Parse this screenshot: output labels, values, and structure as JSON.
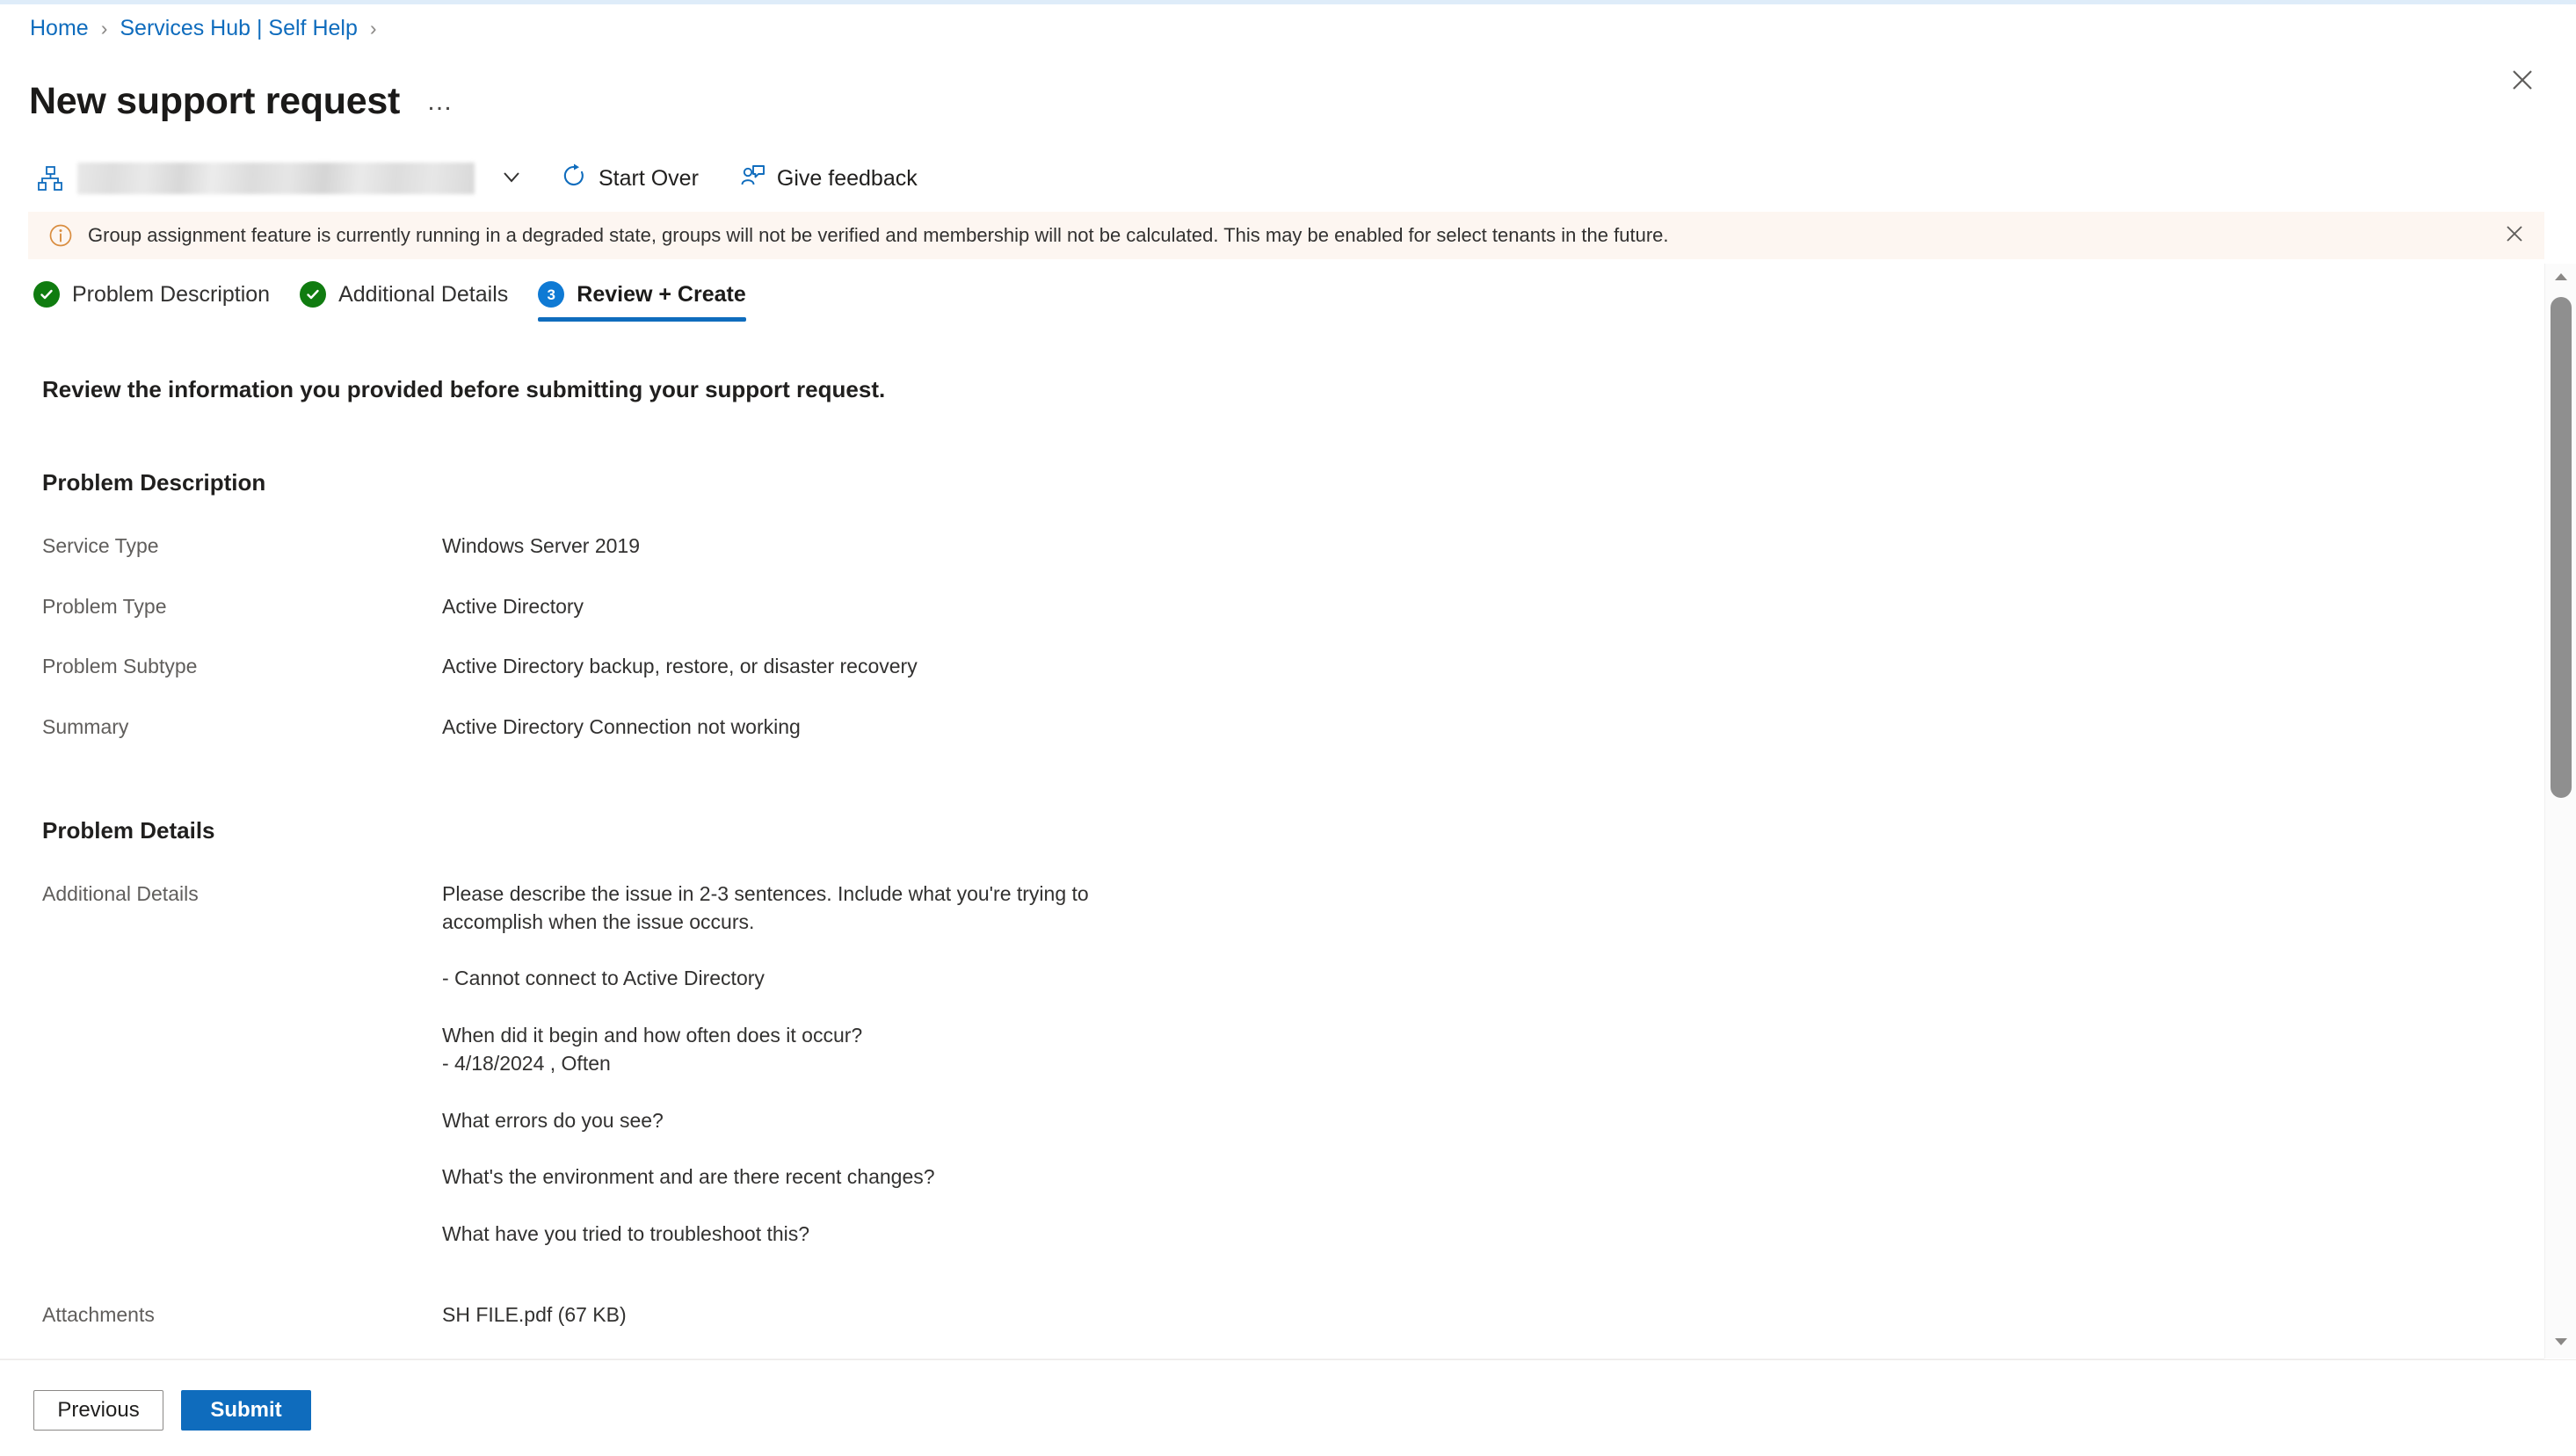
{
  "breadcrumb": {
    "items": [
      {
        "label": "Home"
      },
      {
        "label": "Services Hub | Self Help"
      }
    ],
    "separator": "›"
  },
  "header": {
    "title": "New support request",
    "more_menu_label": "…",
    "close_label": "Close"
  },
  "command_bar": {
    "org_picker": {
      "icon": "org-hierarchy-icon",
      "value": "",
      "redacted": true,
      "chevron": "chevron-down-icon"
    },
    "buttons": [
      {
        "label": "Start Over",
        "icon": "refresh-icon"
      },
      {
        "label": "Give feedback",
        "icon": "feedback-person-icon"
      }
    ]
  },
  "message_bar": {
    "icon": "info-icon",
    "text": "Group assignment feature is currently running in a degraded state, groups will not be verified and membership will not be calculated. This may be enabled for select tenants in the future.",
    "dismiss_label": "Dismiss",
    "background": "#fdf6f1",
    "icon_color": "#d98d3f"
  },
  "wizard": {
    "steps": [
      {
        "label": "Problem Description",
        "state": "done",
        "badge": "✓"
      },
      {
        "label": "Additional Details",
        "state": "done",
        "badge": "✓"
      },
      {
        "label": "Review + Create",
        "state": "current",
        "badge": "3"
      }
    ],
    "done_color": "#107c10",
    "current_color": "#0f7ad4"
  },
  "main": {
    "lead": "Review the information you provided before submitting your support request.",
    "sections": [
      {
        "title": "Problem Description",
        "rows": [
          {
            "label": "Service Type",
            "value": "Windows Server 2019"
          },
          {
            "label": "Problem Type",
            "value": "Active Directory"
          },
          {
            "label": "Problem Subtype",
            "value": "Active Directory backup, restore, or disaster recovery"
          },
          {
            "label": "Summary",
            "value": "Active Directory Connection not working"
          }
        ]
      },
      {
        "title": "Problem Details",
        "additional_details_label": "Additional Details",
        "additional_details_paragraphs": [
          "Please describe the issue in 2-3 sentences. Include what you're trying to accomplish when the issue occurs.",
          "- Cannot connect to Active Directory",
          "When did it begin and how often does it occur?\n- 4/18/2024 , Often",
          "What errors do you see?",
          "What's the environment and are there recent changes?",
          "What have you tried to troubleshoot this?"
        ],
        "attachments_label": "Attachments",
        "attachments_value": "SH FILE.pdf (67 KB)"
      }
    ]
  },
  "footer": {
    "previous_label": "Previous",
    "submit_label": "Submit",
    "primary_color": "#0f6cbd"
  },
  "scrollbar": {
    "up_arrow": "scroll-up-icon",
    "down_arrow": "scroll-down-icon"
  }
}
